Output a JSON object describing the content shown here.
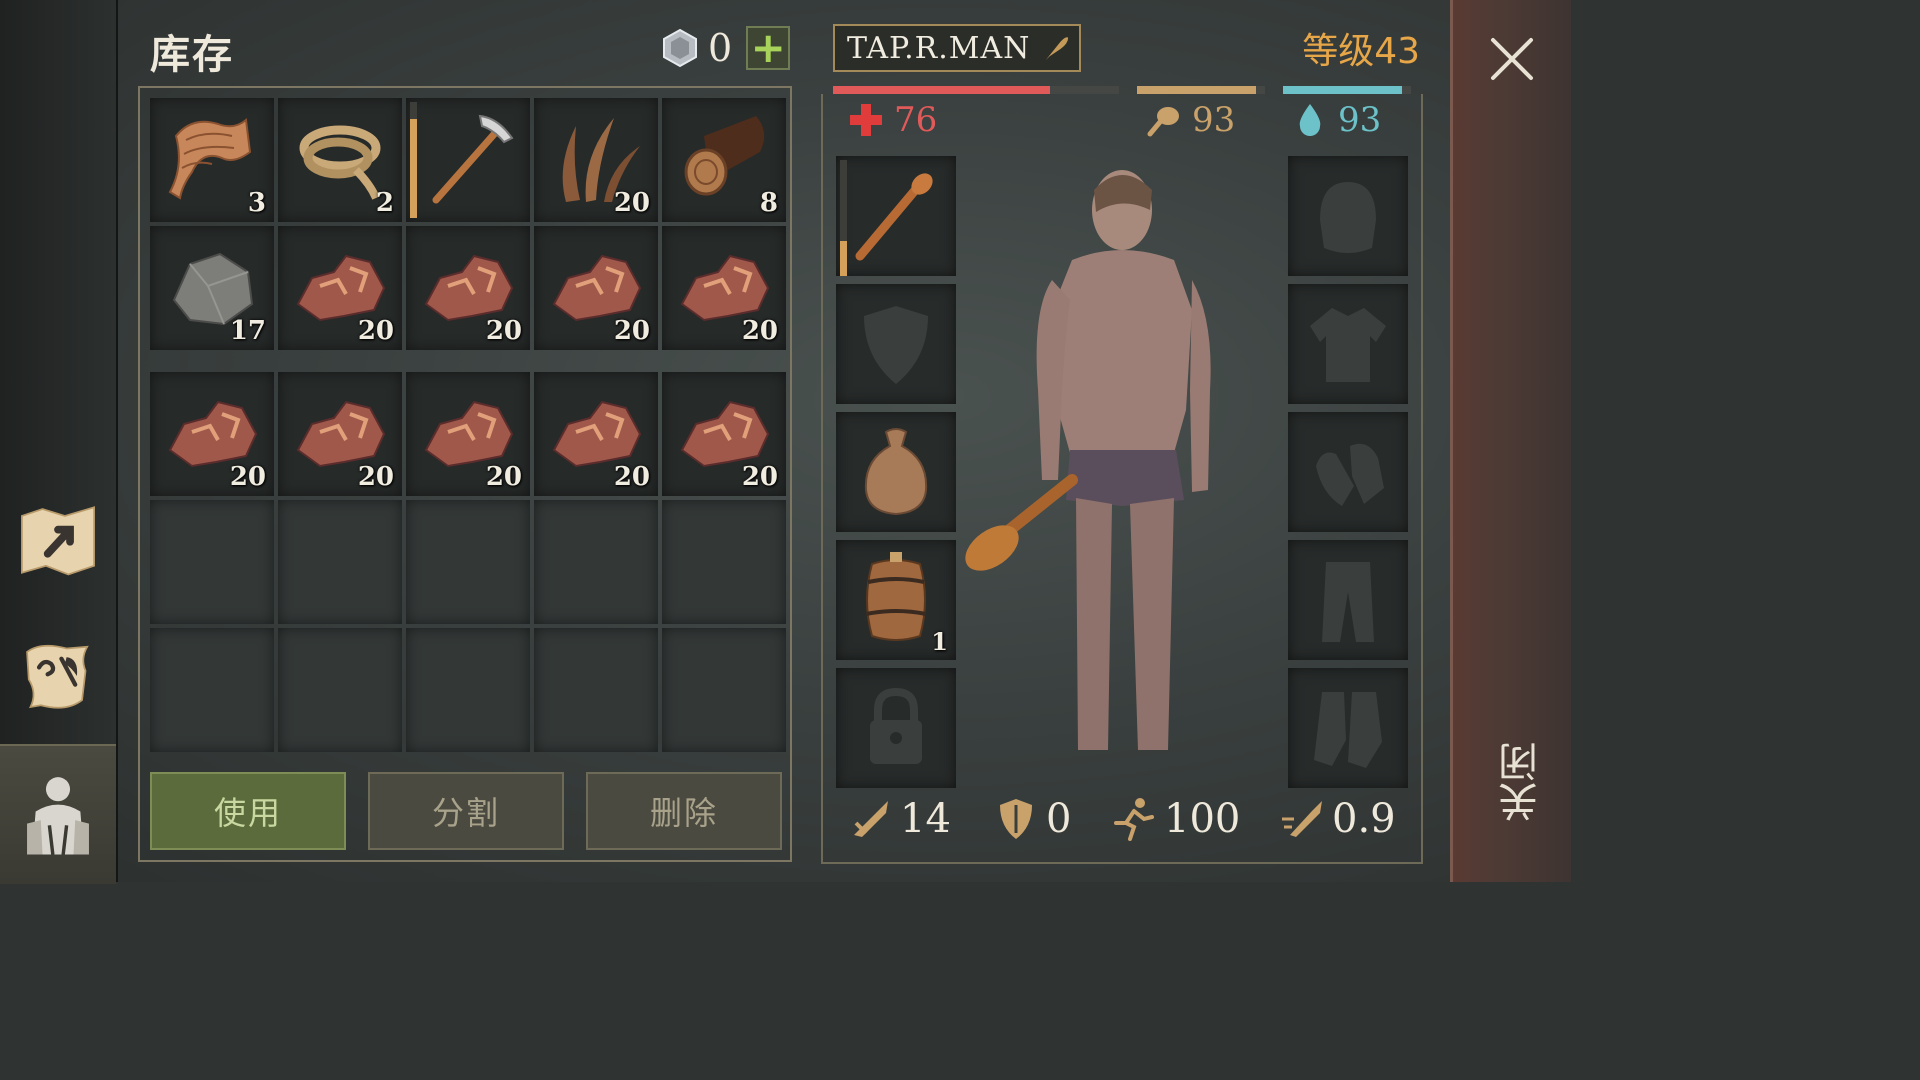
{
  "inventory": {
    "title": "库存",
    "coins": "0",
    "rows": [
      [
        {
          "item": "leather-scrap",
          "qty": "3"
        },
        {
          "item": "rope",
          "qty": "2"
        },
        {
          "item": "pickaxe",
          "qty": "",
          "durability": 0.85
        },
        {
          "item": "plant-fiber",
          "qty": "20"
        },
        {
          "item": "wood-log",
          "qty": "8"
        }
      ],
      [
        {
          "item": "stone",
          "qty": "17"
        },
        {
          "item": "copper-ore",
          "qty": "20"
        },
        {
          "item": "copper-ore",
          "qty": "20"
        },
        {
          "item": "copper-ore",
          "qty": "20"
        },
        {
          "item": "copper-ore",
          "qty": "20"
        }
      ],
      [
        {
          "item": "copper-ore",
          "qty": "20"
        },
        {
          "item": "copper-ore",
          "qty": "20"
        },
        {
          "item": "copper-ore",
          "qty": "20"
        },
        {
          "item": "copper-ore",
          "qty": "20"
        },
        {
          "item": "copper-ore",
          "qty": "20"
        }
      ]
    ]
  },
  "actions": {
    "use": "使用",
    "split": "分割",
    "delete": "删除"
  },
  "character": {
    "name": "TAP.R.MAN",
    "level": "等级43",
    "health": "76",
    "hunger": "93",
    "thirst": "93",
    "bars": {
      "health": 0.76,
      "hunger": 0.93,
      "thirst": 0.93
    },
    "weapon_durability": 0.3,
    "backpack_qty": "1",
    "attack": "14",
    "defense": "0",
    "speed": "100",
    "attack_speed": "0.9"
  },
  "close": {
    "label": "关闭"
  },
  "colors": {
    "health": "#e05a5a",
    "hunger": "#c9a16a",
    "thirst": "#6cc2c8",
    "level": "#e7a648",
    "use_button": "#5b6b3b"
  }
}
